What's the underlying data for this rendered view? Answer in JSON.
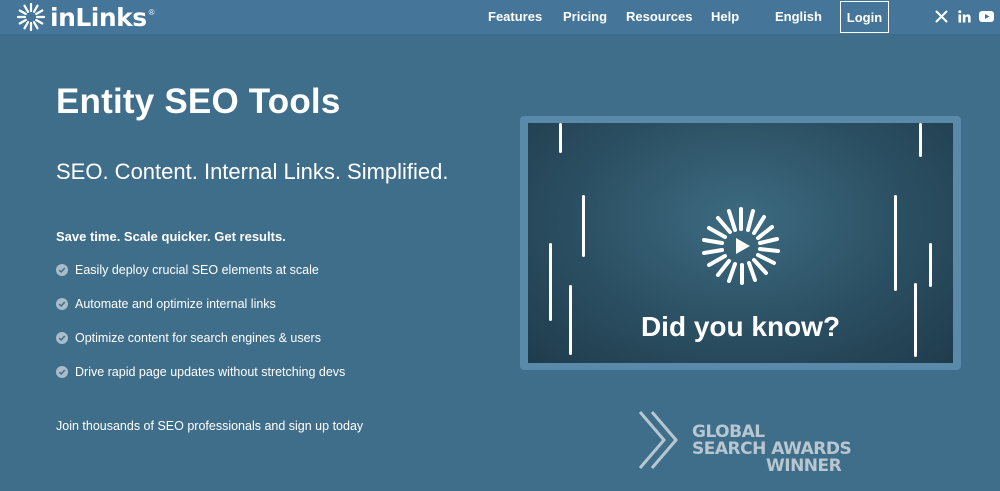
{
  "brand": {
    "name": "inLinks",
    "mark": "®"
  },
  "nav": {
    "items": [
      {
        "label": "Features"
      },
      {
        "label": "Pricing"
      },
      {
        "label": "Resources"
      },
      {
        "label": "Help"
      },
      {
        "label": "English"
      }
    ],
    "login_label": "Login",
    "social": [
      {
        "icon": "x-icon"
      },
      {
        "icon": "linkedin-icon"
      },
      {
        "icon": "youtube-icon"
      }
    ]
  },
  "hero": {
    "title": "Entity SEO Tools",
    "subtitle": "SEO. Content. Internal Links. Simplified.",
    "tagline": "Save time. Scale quicker. Get results.",
    "features": [
      "Easily deploy crucial SEO elements at scale",
      "Automate and optimize internal links",
      "Optimize content for search engines & users",
      "Drive rapid page updates without stretching devs"
    ],
    "cta_text": "Join thousands of SEO professionals and sign up today"
  },
  "video": {
    "caption": "Did you know?"
  },
  "award": {
    "lines": [
      "GLOBAL",
      "SEARCH AWARDS",
      "WINNER"
    ]
  },
  "colors": {
    "background": "#3f6e8b",
    "navbar": "#45769a",
    "video_bg": "#2b4f62",
    "check": "#a9bcc9",
    "award_text": "#b8c6cf"
  }
}
